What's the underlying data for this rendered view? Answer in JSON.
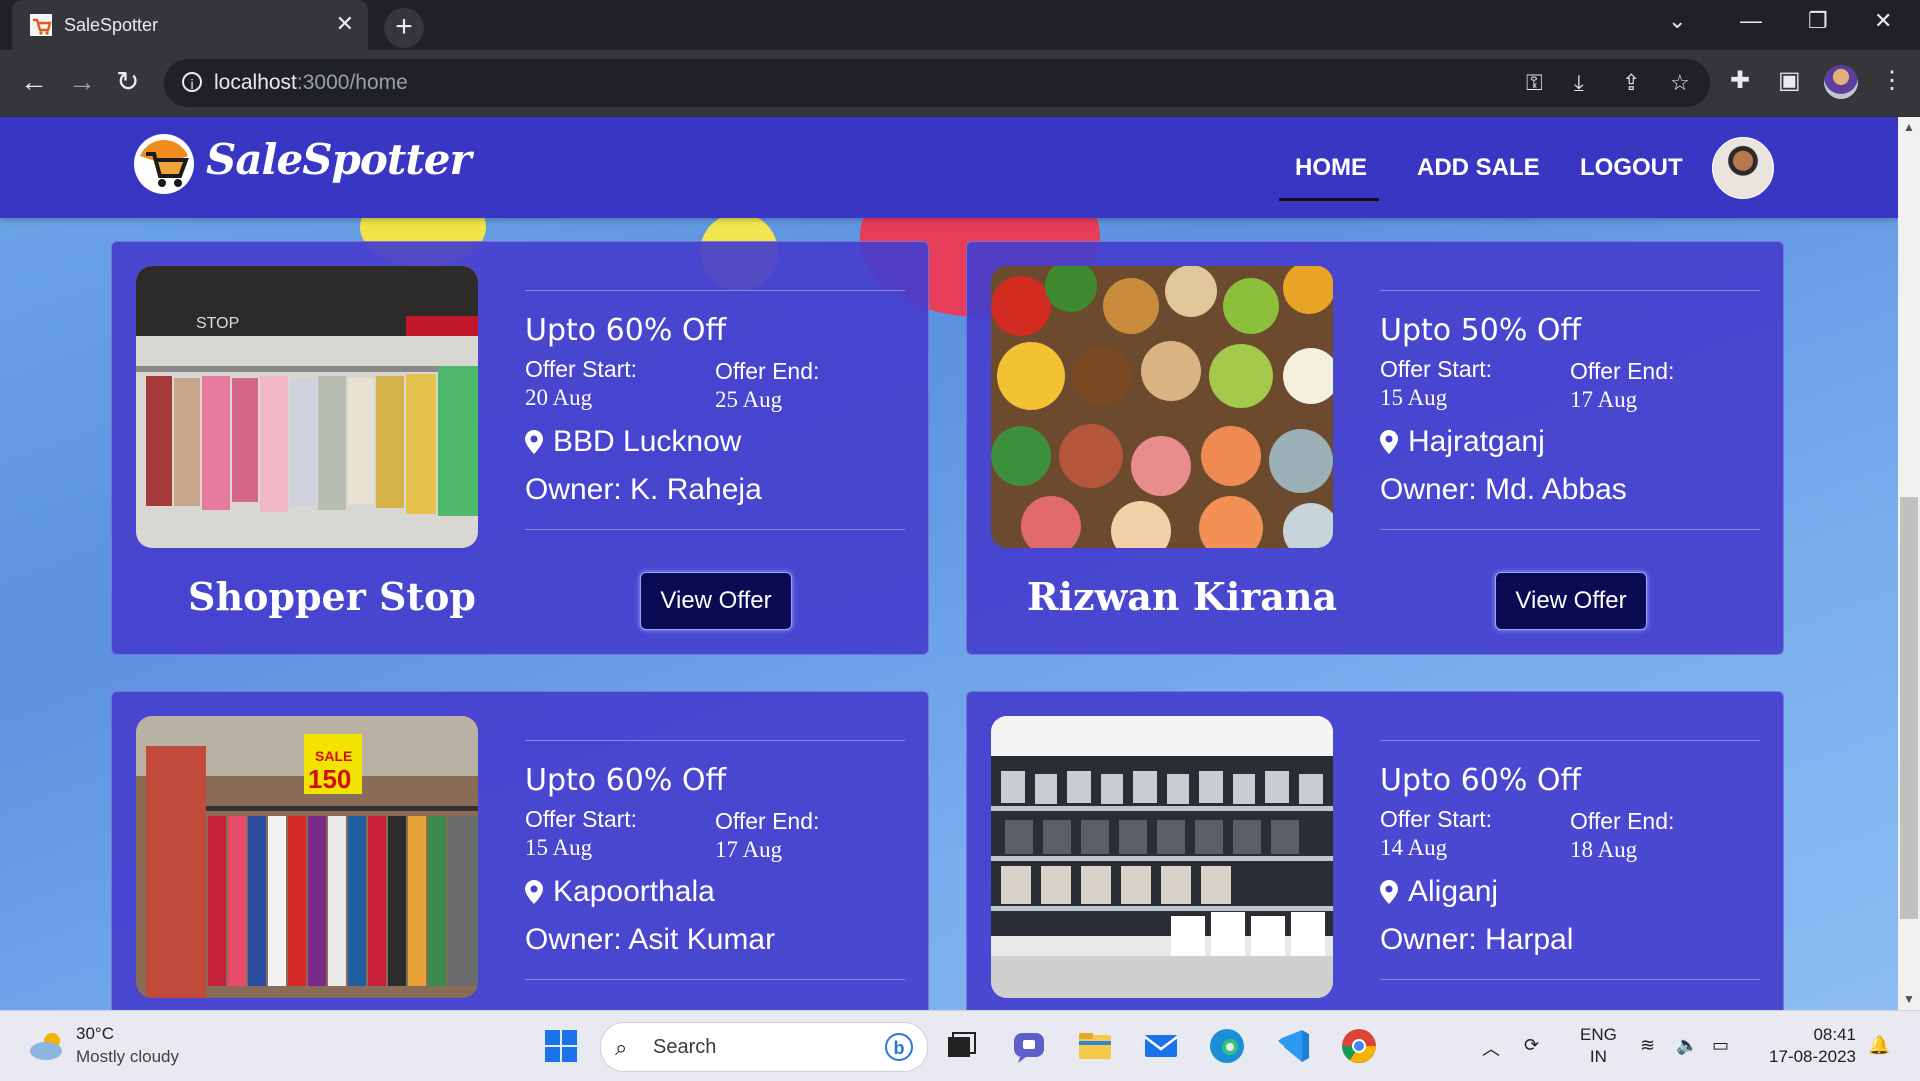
{
  "browser": {
    "tab_title": "SaleSpotter",
    "url_host": "localhost",
    "url_rest": ":3000/home"
  },
  "app": {
    "logo_text": "SaleSpotter",
    "nav": {
      "home": "HOME",
      "add_sale": "ADD SALE",
      "logout": "LOGOUT"
    }
  },
  "cards": [
    {
      "discount": "Upto 60% Off",
      "start_label": "Offer Start:",
      "start": "20 Aug",
      "end_label": "Offer End:",
      "end": "25 Aug",
      "location": "BBD Lucknow",
      "owner": "Owner: K. Raheja",
      "name": "Shopper Stop",
      "button": "View Offer"
    },
    {
      "discount": "Upto 50% Off",
      "start_label": "Offer Start:",
      "start": "15 Aug",
      "end_label": "Offer End:",
      "end": "17 Aug",
      "location": "Hajratganj",
      "owner": "Owner: Md. Abbas",
      "name": "Rizwan Kirana",
      "button": "View Offer"
    },
    {
      "discount": "Upto 60% Off",
      "start_label": "Offer Start:",
      "start": "15 Aug",
      "end_label": "Offer End:",
      "end": "17 Aug",
      "location": "Kapoorthala",
      "owner": "Owner: Asit Kumar",
      "name": "",
      "button": ""
    },
    {
      "discount": "Upto 60% Off",
      "start_label": "Offer Start:",
      "start": "14 Aug",
      "end_label": "Offer End:",
      "end": "18 Aug",
      "location": "Aliganj",
      "owner": "Owner: Harpal",
      "name": "",
      "button": ""
    }
  ],
  "card_images": [
    "clothing-store-photo",
    "groceries-photo",
    "market-clothes-photo",
    "appliance-shelves-photo"
  ],
  "sale_sign": {
    "word": "SALE",
    "price": "150"
  },
  "taskbar": {
    "weather_temp": "30°C",
    "weather_desc": "Mostly cloudy",
    "search_placeholder": "Search",
    "lang_top": "ENG",
    "lang_bottom": "IN",
    "time": "08:41",
    "date": "17-08-2023"
  },
  "colors": {
    "navbar": "#3a36c4",
    "card": "#463ecd",
    "button": "#0b0b54",
    "chrome_bg": "#202124"
  }
}
